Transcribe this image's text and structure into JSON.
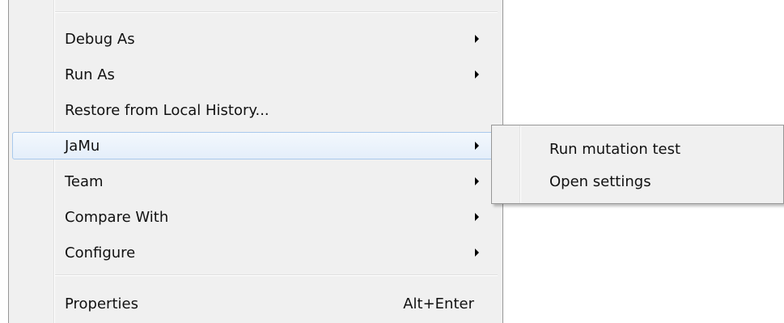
{
  "context_menu": {
    "items": [
      {
        "label": "Debug As",
        "has_submenu": true
      },
      {
        "label": "Run As",
        "has_submenu": true
      },
      {
        "label": "Restore from Local History...",
        "has_submenu": false
      },
      {
        "label": "JaMu",
        "has_submenu": true,
        "highlighted": true
      },
      {
        "label": "Team",
        "has_submenu": true
      },
      {
        "label": "Compare With",
        "has_submenu": true
      },
      {
        "label": "Configure",
        "has_submenu": true
      },
      {
        "label": "Properties",
        "shortcut": "Alt+Enter",
        "has_submenu": false
      }
    ]
  },
  "jamu_submenu": {
    "items": [
      {
        "label": "Run mutation test"
      },
      {
        "label": "Open settings"
      }
    ]
  },
  "colors": {
    "menu_background": "#f0f0f0",
    "menu_border": "#979797",
    "highlight_border": "#a9c9ec",
    "highlight_fill": "#e4eefa"
  }
}
